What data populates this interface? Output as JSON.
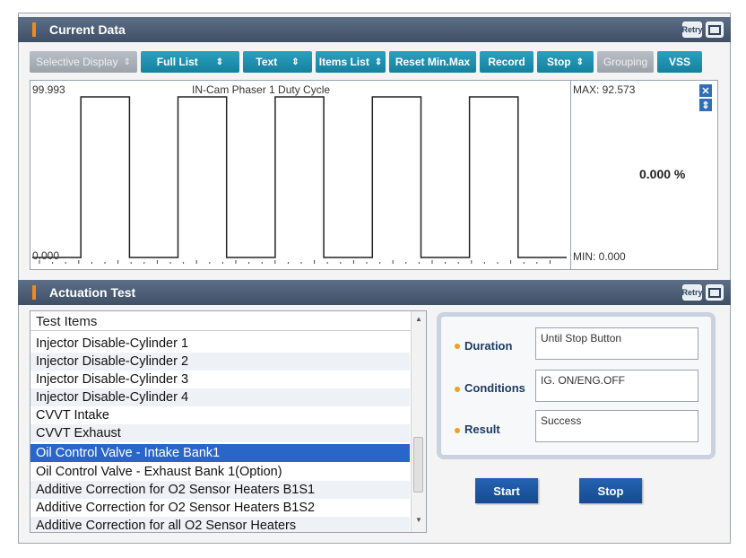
{
  "current_data": {
    "title": "Current Data",
    "retry_icon_label": "Retry",
    "toolbar": [
      {
        "label": "Selective Display",
        "arrows": "⇕",
        "disabled": true
      },
      {
        "label": "Full List",
        "arrows": "⇕",
        "disabled": false
      },
      {
        "label": "Text",
        "arrows": "⇕",
        "disabled": false
      },
      {
        "label": "Items List",
        "arrows": "⇕",
        "disabled": false
      },
      {
        "label": "Reset Min.Max",
        "arrows": "",
        "disabled": false
      },
      {
        "label": "Record",
        "arrows": "",
        "disabled": false
      },
      {
        "label": "Stop",
        "arrows": "⇕",
        "disabled": false
      },
      {
        "label": "Grouping",
        "arrows": "",
        "disabled": true
      },
      {
        "label": "VSS",
        "arrows": "",
        "disabled": false
      }
    ],
    "graph": {
      "title": "IN-Cam Phaser 1 Duty Cycle",
      "y_max_label": "99.993",
      "y_min_label": "0.000",
      "max_label": "MAX: 92.573",
      "min_label": "MIN: 0.000",
      "current_value": "0.000 %",
      "close_icon": "close-icon",
      "expand_icon": "updown-icon",
      "line_color": "#222222",
      "waveform": [
        0,
        0,
        1,
        1,
        0,
        0,
        1,
        1,
        0,
        0,
        1,
        1,
        0,
        0,
        1,
        1,
        0,
        0,
        1,
        1,
        0,
        0
      ]
    }
  },
  "actuation_test": {
    "title": "Actuation Test",
    "retry_icon_label": "Retry",
    "list_header": "Test Items",
    "items": [
      "Injector Disable-Cylinder 1",
      "Injector Disable-Cylinder 2",
      "Injector Disable-Cylinder 3",
      "Injector Disable-Cylinder 4",
      "CVVT Intake",
      "CVVT Exhaust",
      "Oil Control Valve - Intake Bank1",
      "Oil Control Valve - Exhaust Bank 1(Option)",
      "Additive Correction for O2 Sensor Heaters B1S1",
      "Additive Correction for O2 Sensor Heaters B1S2",
      "Additive Correction for all O2 Sensor Heaters"
    ],
    "selected_index": 6,
    "duration_label": "Duration",
    "duration_value": "Until Stop Button",
    "conditions_label": "Conditions",
    "conditions_value": "IG. ON/ENG.OFF",
    "result_label": "Result",
    "result_value": "Success",
    "start_label": "Start",
    "stop_label": "Stop"
  },
  "colors": {
    "header": "#4a5b73",
    "toolbar_button": "#1e93b3",
    "selected_row": "#2a66c9",
    "action_button": "#1f58a3",
    "accent": "#f08a1c"
  }
}
